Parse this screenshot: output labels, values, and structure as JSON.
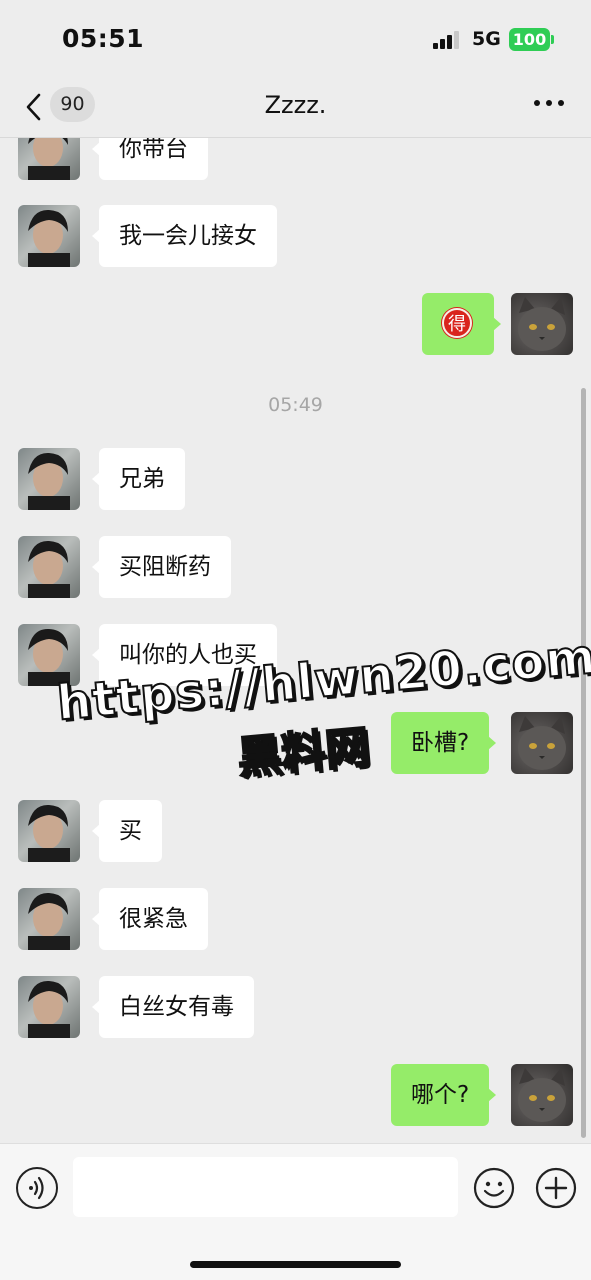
{
  "status_bar": {
    "time": "05:51",
    "network": "5G",
    "battery": "100"
  },
  "nav": {
    "unread_count": "90",
    "title": "Zzzz."
  },
  "messages": {
    "m1": "你带台",
    "m2": "我一会儿接女",
    "m3_emoji": "得",
    "timestamp": "05:49",
    "m4": "兄弟",
    "m5": "买阻断药",
    "m6": "叫你的人也买",
    "m7": "卧槽?",
    "m8": "买",
    "m9": "很紧急",
    "m10": "白丝女有毒",
    "m11": "哪个?"
  },
  "watermark": {
    "url": "https://hlwn20.com",
    "name": "黑料网"
  },
  "input": {
    "placeholder": ""
  },
  "colors": {
    "background": "#ededed",
    "bubble_self": "#95ec69",
    "bubble_other": "#ffffff",
    "battery": "#2fcd55"
  }
}
